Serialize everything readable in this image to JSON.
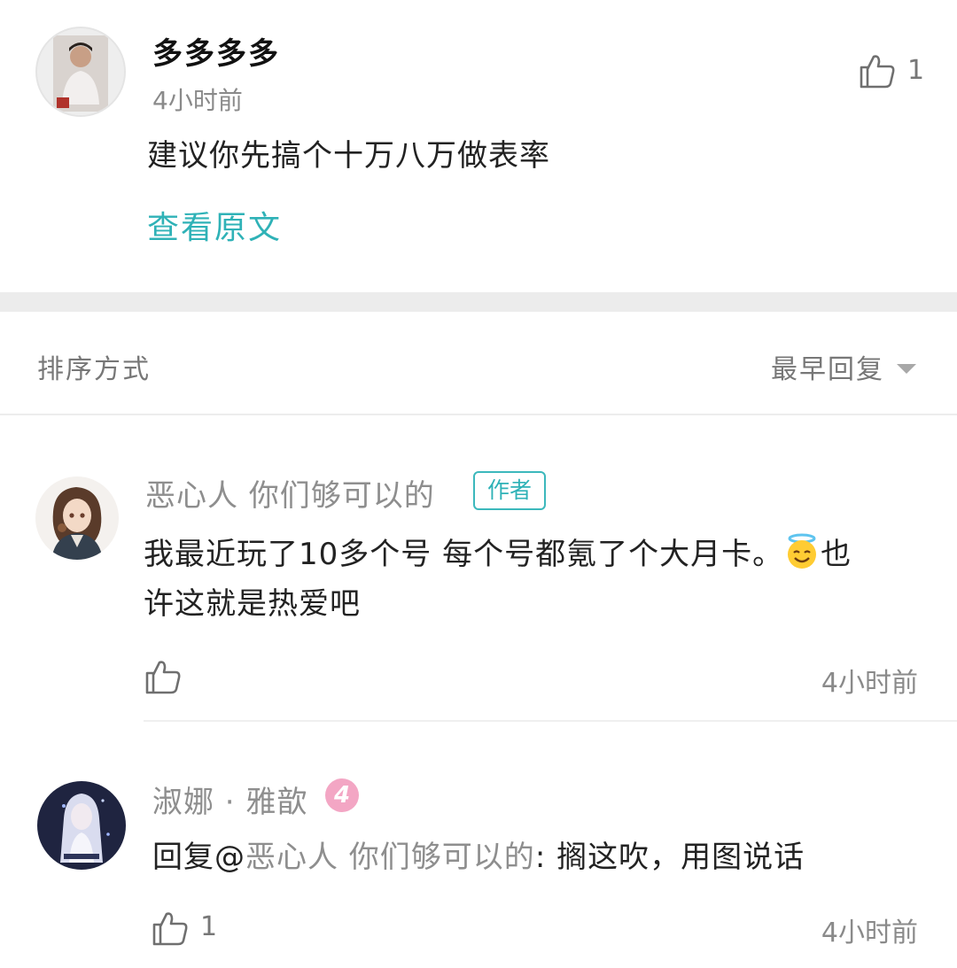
{
  "top_comment": {
    "username": "多多多多",
    "time": "4小时前",
    "body": "建议你先搞个十万八万做表率",
    "view_original": "查看原文",
    "like_count": "1"
  },
  "sort": {
    "label": "排序方式",
    "selected": "最早回复"
  },
  "replies": [
    {
      "username": "恶心人 你们够可以的",
      "badge": "作者",
      "body_line1": "我最近玩了10多个号 每个号都氪了个大月卡。",
      "emoji": "smiling-face-with-halo-emoji",
      "body_line1_end": "也",
      "body_line2": "许这就是热爱吧",
      "time": "4小时前"
    },
    {
      "username": "淑娜 · 雅歆",
      "level": "4",
      "reply_prefix": "回复@",
      "reply_target": "恶心人 你们够可以的",
      "reply_text": ": 搁这吹，用图说话",
      "like_count": "1",
      "time": "4小时前"
    }
  ],
  "colors": {
    "accent": "#2fb2b7",
    "secondary_text": "#8e8e8e",
    "separator": "#ececec",
    "level_badge": "#f3a6c4"
  }
}
